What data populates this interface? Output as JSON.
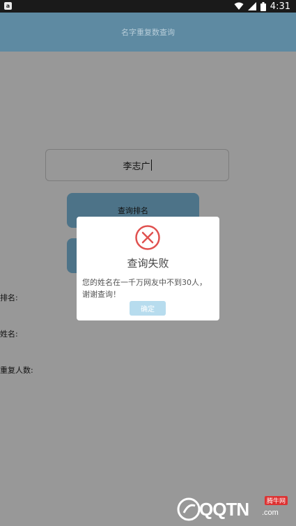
{
  "status_bar": {
    "time": "4:31",
    "notification_icon": "a"
  },
  "appbar": {
    "title": "名字重复数查询"
  },
  "search": {
    "value": "李志广"
  },
  "buttons": {
    "rank_label": "查询排名",
    "second_label": ""
  },
  "labels": {
    "rank": "排名:",
    "name": "姓名:",
    "duplicates": "重复人数:"
  },
  "dialog": {
    "title": "查询失败",
    "message": "您的姓名在一千万网友中不到30人，谢谢查询！",
    "ok_label": "确定"
  },
  "watermark": {
    "brand": "QQTN",
    "domain": ".com",
    "tag": "腾牛网"
  },
  "colors": {
    "appbar": "#5e8aa2",
    "overlay": "#989898",
    "error": "#e0514f",
    "ok_button": "#b7dcee"
  }
}
